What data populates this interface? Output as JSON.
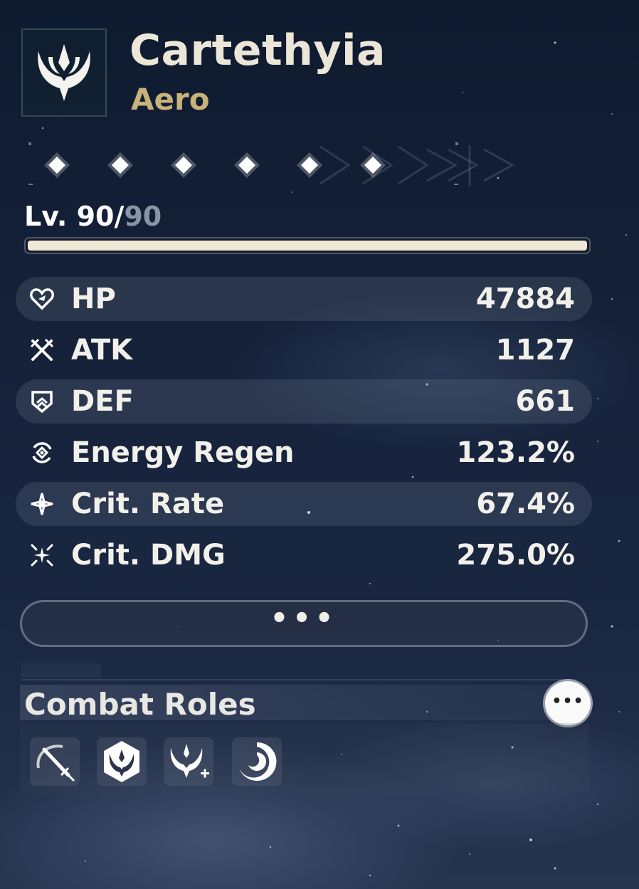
{
  "character": {
    "name": "Cartethyia",
    "element": "Aero",
    "icon": "aero-element-icon"
  },
  "resonance": {
    "nodes": 6,
    "unlocked": 6
  },
  "level": {
    "prefix": "Lv. ",
    "current": "90",
    "separator": "/",
    "max": "90",
    "progress": 1.0
  },
  "stats": [
    {
      "label": "HP",
      "value": "47884",
      "icon": "hp-heart-icon"
    },
    {
      "label": "ATK",
      "value": "1127",
      "icon": "atk-swords-icon"
    },
    {
      "label": "DEF",
      "value": "661",
      "icon": "def-shield-icon"
    },
    {
      "label": "Energy Regen",
      "value": "123.2%",
      "icon": "energy-regen-icon"
    },
    {
      "label": "Crit. Rate",
      "value": "67.4%",
      "icon": "crit-rate-icon"
    },
    {
      "label": "Crit. DMG",
      "value": "275.0%",
      "icon": "crit-dmg-icon"
    }
  ],
  "more_button": {
    "label": "•••"
  },
  "combat_roles": {
    "title": "Combat Roles",
    "more_label": "•••",
    "roles": [
      {
        "icon": "sword-slash-role-icon"
      },
      {
        "icon": "aero-crest-role-icon"
      },
      {
        "icon": "aero-plus-role-icon"
      },
      {
        "icon": "swirl-role-icon"
      }
    ]
  },
  "colors": {
    "accent_gold": "#c8b27a",
    "text": "#f2f0ea",
    "bar_fill": "#efe8d4",
    "level_max": "#8a94a4"
  }
}
